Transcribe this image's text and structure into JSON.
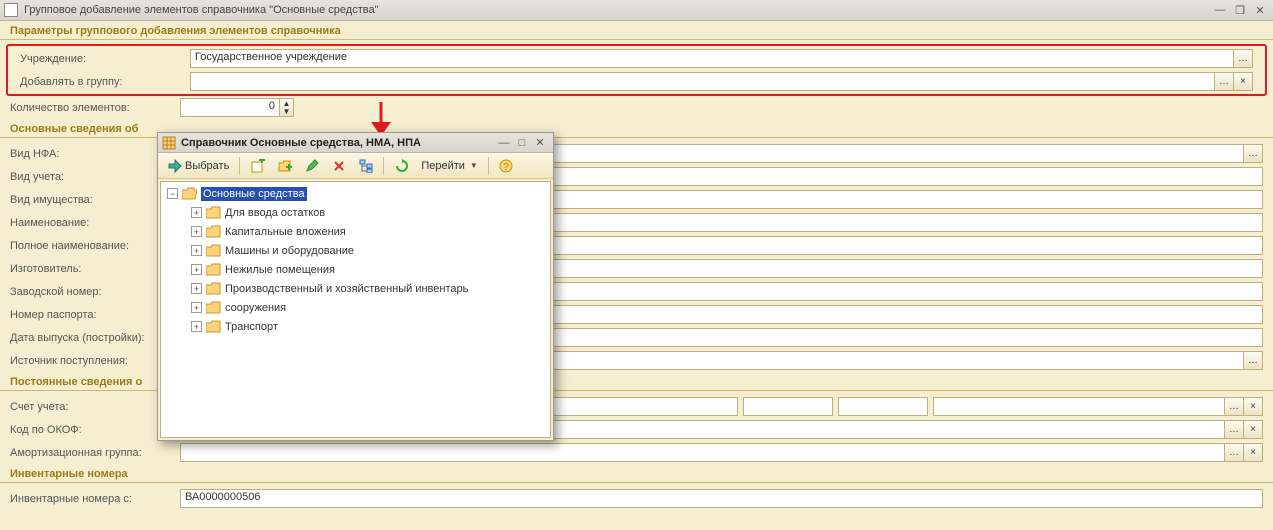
{
  "window": {
    "title": "Групповое добавление элементов справочника \"Основные средства\""
  },
  "sections": {
    "params": "Параметры группового добавления элементов справочника",
    "main": "Основные сведения об",
    "const": "Постоянные сведения о",
    "inv": "Инвентарные номера"
  },
  "labels": {
    "org": "Учреждение:",
    "group": "Добавлять в группу:",
    "count": "Количество элементов:",
    "nfaType": "Вид НФА:",
    "accType": "Вид учета:",
    "propType": "Вид имущества:",
    "name": "Наименование:",
    "fullName": "Полное наименование:",
    "maker": "Изготовитель:",
    "serial": "Заводской номер:",
    "passport": "Номер паспорта:",
    "buildDate": "Дата выпуска (постройки):",
    "source": "Источник поступления:",
    "account": "Счет учета:",
    "okof": "Код по ОКОФ:",
    "amort": "Амортизационная группа:",
    "invFrom": "Инвентарные номера с:"
  },
  "values": {
    "org": "Государственное учреждение",
    "count": "0",
    "invFrom": "ВА0000000506"
  },
  "popup": {
    "title": "Справочник Основные средства, НМА, НПА",
    "toolbar": {
      "select": "Выбрать",
      "goto": "Перейти"
    },
    "tree": {
      "root": "Основные средства",
      "children": [
        "Для ввода остатков",
        "Капитальные вложения",
        "Машины и оборудование",
        "Нежилые помещения",
        "Производственный и хозяйственный инвентарь",
        "сооружения",
        "Транспорт"
      ]
    }
  }
}
